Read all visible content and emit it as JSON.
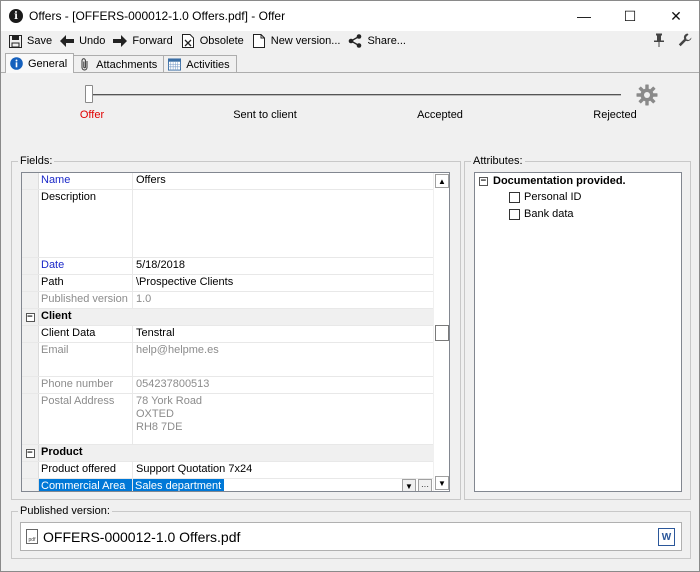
{
  "window": {
    "title": "Offers - [OFFERS-000012-1.0 Offers.pdf] - Offer",
    "minimize_glyph": "—",
    "maximize_glyph": "☐",
    "close_glyph": "✕"
  },
  "toolbar": {
    "save_label": "Save",
    "undo_label": "Undo",
    "forward_label": "Forward",
    "obsolete_label": "Obsolete",
    "new_version_label": "New version...",
    "share_label": "Share..."
  },
  "tabs": [
    {
      "label": "General",
      "icon": "info-icon",
      "active": true
    },
    {
      "label": "Attachments",
      "icon": "paperclip-icon",
      "active": false
    },
    {
      "label": "Activities",
      "icon": "calendar-icon",
      "active": false
    }
  ],
  "workflow": {
    "states": [
      "Offer",
      "Sent to client",
      "Accepted",
      "Rejected"
    ],
    "current_state": "Offer",
    "current_color": "#e00000",
    "settings_icon": "gear-icon"
  },
  "fields": {
    "title": "Fields:",
    "rows": {
      "name": {
        "label": "Name",
        "value": "Offers"
      },
      "description": {
        "label": "Description",
        "value": ""
      },
      "date": {
        "label": "Date",
        "value": "5/18/2018"
      },
      "path": {
        "label": "Path",
        "value": "\\Prospective Clients"
      },
      "published_version": {
        "label": "Published version",
        "value": "1.0"
      },
      "client_category": {
        "label": "Client"
      },
      "client_data": {
        "label": "Client Data",
        "value": "Tenstral"
      },
      "email": {
        "label": "Email",
        "value": "help@helpme.es"
      },
      "phone": {
        "label": "Phone number",
        "value": "054237800513"
      },
      "postal_address": {
        "label": "Postal Address",
        "value": "78 York Road\nOXTED\nRH8 7DE"
      },
      "product_category": {
        "label": "Product"
      },
      "product_offered": {
        "label": "Product offered",
        "value": "Support Quotation 7x24"
      },
      "commercial_area": {
        "label": "Commercial Area",
        "value": "Sales department"
      }
    },
    "expander_glyph": "−",
    "dropdown_glyph": "▼",
    "ellipsis_glyph": "···",
    "scroll_up_glyph": "▲",
    "scroll_down_glyph": "▼"
  },
  "attributes": {
    "title": "Attributes:",
    "root": "Documentation provided.",
    "items": [
      {
        "label": "Personal ID",
        "checked": false
      },
      {
        "label": "Bank data",
        "checked": false
      }
    ]
  },
  "published": {
    "title": "Published version:",
    "filename": "OFFERS-000012-1.0 Offers.pdf",
    "file_icon": "pdf-file-icon",
    "open_icon": "word-icon"
  },
  "colors": {
    "label_blue": "#1a28c8",
    "readonly_gray": "#8c8c8c",
    "selection": "#0078d7"
  }
}
